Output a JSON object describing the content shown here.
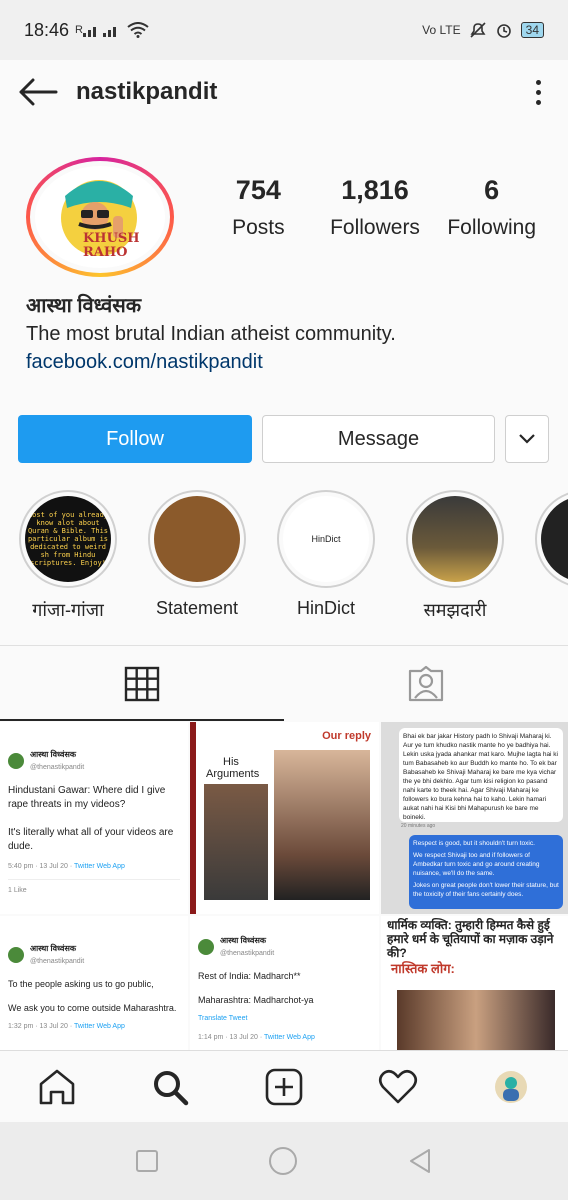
{
  "status_bar": {
    "time": "18:46",
    "network": "R",
    "volte": "Vo LTE",
    "battery": "34"
  },
  "header": {
    "username": "nastikpandit"
  },
  "profile": {
    "avatar_text": "KHUSH RAHO",
    "stats": [
      {
        "value": "754",
        "label": "Posts"
      },
      {
        "value": "1,816",
        "label": "Followers"
      },
      {
        "value": "6",
        "label": "Following"
      }
    ],
    "name": "आस्था विध्वंसक",
    "bio": "The most brutal Indian atheist community.",
    "link": "facebook.com/nastikpandit"
  },
  "actions": {
    "follow": "Follow",
    "message": "Message"
  },
  "highlights": [
    {
      "label": "गांजा-गांजा",
      "cover_text": "Most of you already know alot about Quran & Bible. This particular album is dedicated to weird sh from Hindu scriptures. Enjoy!"
    },
    {
      "label": "Statement",
      "cover_text": ""
    },
    {
      "label": "HinDict",
      "cover_text": "HinDict"
    },
    {
      "label": "समझदारी",
      "cover_text": ""
    }
  ],
  "posts": [
    {
      "account": "आस्था विध्वंसक",
      "handle": "@thenastikpandit",
      "text": "Hindustani Gawar: Where did I give rape threats in my videos?\n\nIt's literally what all of your videos are dude.",
      "time": "5:40 pm · 13 Jul 20 · ",
      "app": "Twitter Web App",
      "likes": "1 Like"
    },
    {
      "his": "His Arguments",
      "reply": "Our reply"
    },
    {
      "chat_left": "Bhai ek bar jakar History padh lo Shivaji Maharaj ki. Aur ye tum khudko nastik mante ho ye badhiya hai. Lekin uska jyada ahankar mat karo. Mujhe lagta hai ki tum Babasaheb ko aur Buddh ko mante ho. To ek bar Babasaheb ke Shivaji Maharaj ke bare me kya vichar the ye bhi dekhlo. Agar tum kisi religion ko pasand nahi karte to theek hai. Agar Shivaji Maharaj ke followers ko bura kehna hai to kaho. Lekin hamari aukat nahi hai Kisi bhi Mahapurush ke bare me boineki.",
      "chat_time": "20 minutes ago",
      "chat_right_1": "Respect is good, but it shouldn't turn toxic.",
      "chat_right_2": "We respect Shivaji too and if followers of Ambedkar turn toxic and go around creating nuisance, we'll do the same.",
      "chat_right_3": "Jokes on great people don't lower their stature, but the toxicity of their fans certainly does."
    },
    {
      "account": "आस्था विध्वंसक",
      "handle": "@thenastikpandit",
      "text": "To the people asking us to go public,\n\nWe ask you to come outside Maharashtra.",
      "time": "1:32 pm · 13 Jul 20 · ",
      "app": "Twitter Web App"
    },
    {
      "account": "आस्था विध्वंसक",
      "handle": "@thenastikpandit",
      "text": "Rest of India: Madharch**\n\nMaharashtra: Madharchot-ya",
      "translate": "Translate Tweet",
      "time": "1:14 pm · 13 Jul 20 · ",
      "app": "Twitter Web App"
    },
    {
      "headline": "धार्मिक व्यक्ति: तुम्हारी हिम्मत कैसे हुई हमारे धर्म के चूतियापों का मज़ाक उड़ाने की?",
      "subhead": "नास्तिक लोग:"
    }
  ],
  "colors": {
    "accent": "#1e9bf0",
    "link": "#00376b"
  }
}
